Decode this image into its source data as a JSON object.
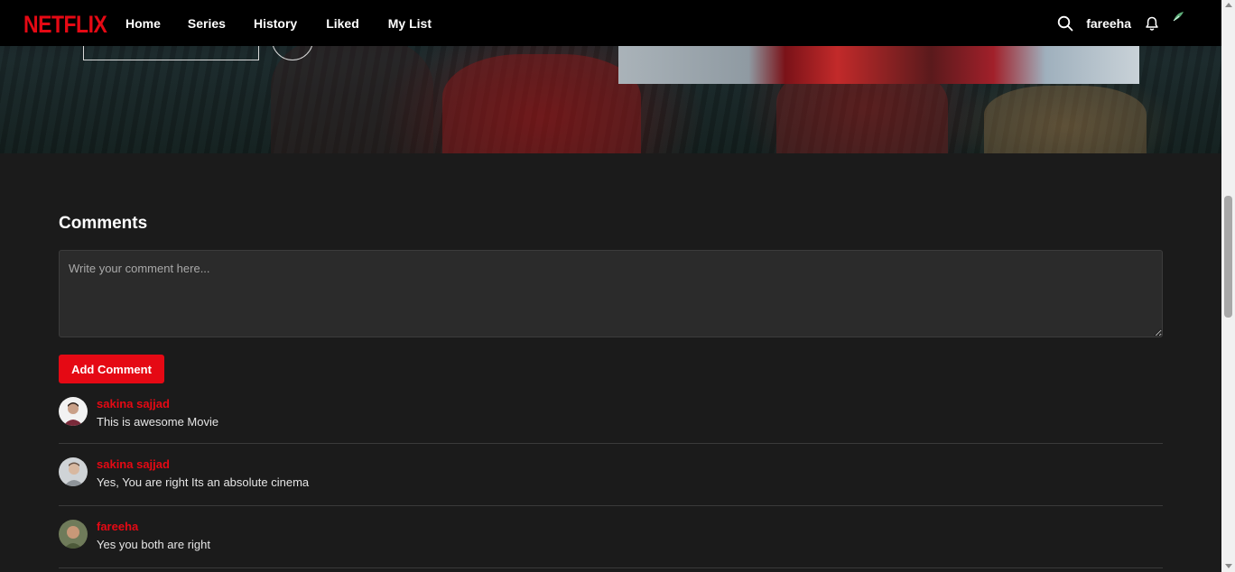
{
  "navbar": {
    "logo": "NETFLIX",
    "links": [
      {
        "label": "Home"
      },
      {
        "label": "Series"
      },
      {
        "label": "History"
      },
      {
        "label": "Liked"
      },
      {
        "label": "My List"
      }
    ],
    "username": "fareeha",
    "icons": [
      "search-icon",
      "bell-icon",
      "profile-avatar-icon"
    ]
  },
  "comments": {
    "title": "Comments",
    "input_placeholder": "Write your comment here...",
    "add_button_label": "Add Comment",
    "items": [
      {
        "user": "sakina sajjad",
        "text": "This is awesome Movie"
      },
      {
        "user": "sakina sajjad",
        "text": "Yes, You are right Its an absolute cinema"
      },
      {
        "user": "fareeha",
        "text": "Yes you both are right"
      }
    ]
  },
  "colors": {
    "brand": "#e50914",
    "background": "#1b1b1b",
    "navbar": "#000000",
    "input_bg": "#2b2b2b"
  }
}
